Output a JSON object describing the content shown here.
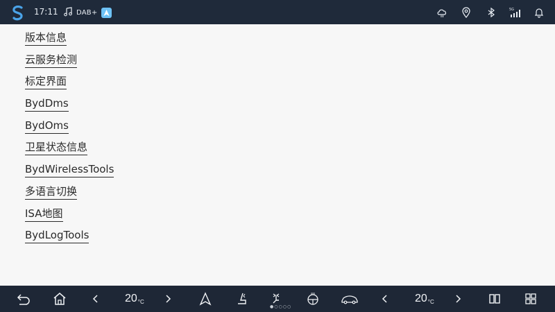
{
  "status_bar": {
    "time": "17:11",
    "media_label": "DAB+",
    "icons": [
      "s-logo-icon",
      "music-note-icon",
      "navigation-app-icon",
      "weather-cloud-icon",
      "location-pin-icon",
      "bluetooth-icon",
      "signal-5g-icon",
      "bell-icon"
    ]
  },
  "menu": {
    "items": [
      {
        "label": "版本信息"
      },
      {
        "label": "云服务检测"
      },
      {
        "label": "标定界面"
      },
      {
        "label": "BydDms"
      },
      {
        "label": "BydOms"
      },
      {
        "label": "卫星状态信息"
      },
      {
        "label": "BydWirelessTools"
      },
      {
        "label": "多语言切换"
      },
      {
        "label": "ISA地图"
      },
      {
        "label": "BydLogTools"
      }
    ]
  },
  "bottom_bar": {
    "left_temp": "20",
    "right_temp": "20",
    "temp_unit": "°C",
    "icons": [
      "back-icon",
      "home-icon",
      "chevron-left-icon",
      "chevron-right-icon",
      "navigation-arrow-icon",
      "seat-heating-icon",
      "fan-airflow-icon",
      "steering-heat-icon",
      "car-icon",
      "chevron-left-icon",
      "chevron-right-icon",
      "split-screen-icon",
      "apps-grid-icon"
    ]
  },
  "colors": {
    "status_bar_bg": "#1f2a3a",
    "bottom_bar_bg": "#1e2736",
    "page_bg": "#f7f7f7",
    "accent_nav_app": "#6ec2f5"
  }
}
